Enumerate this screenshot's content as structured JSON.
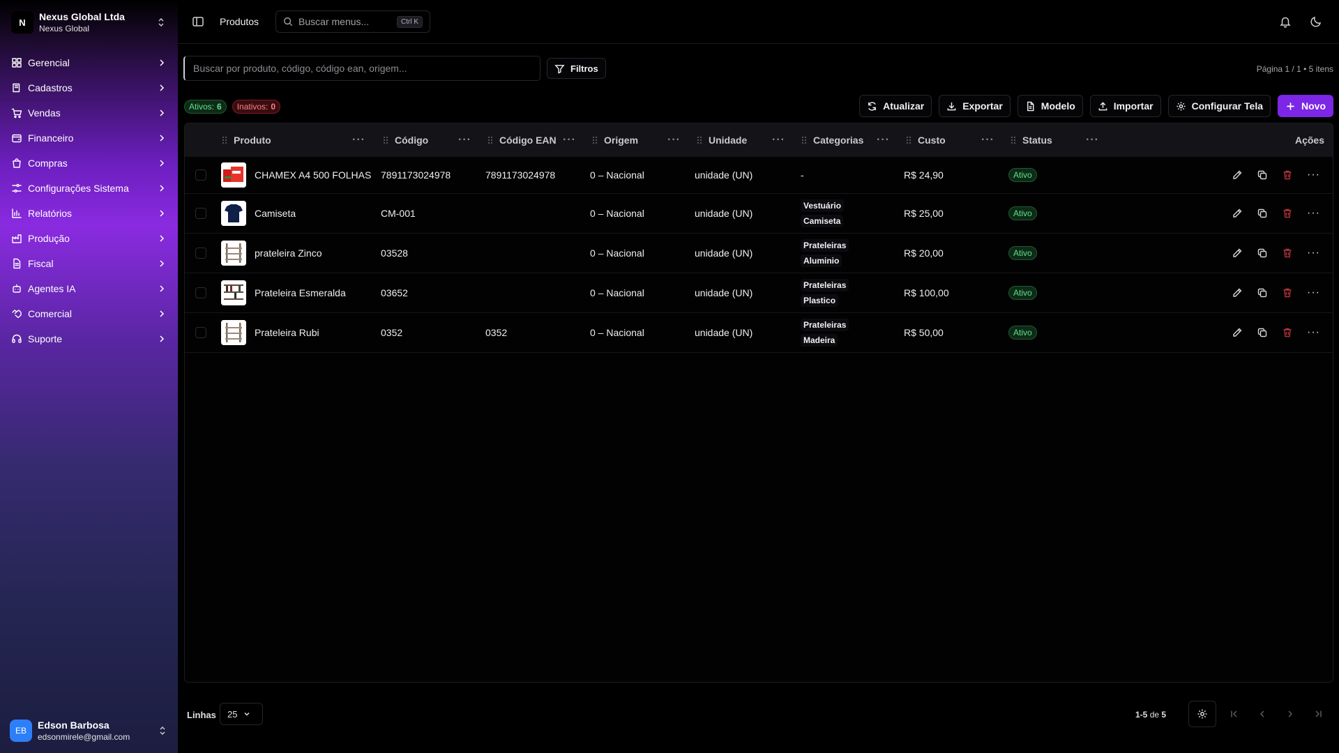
{
  "company": {
    "initial": "N",
    "name": "Nexus Global Ltda",
    "sub": "Nexus Global"
  },
  "nav": [
    {
      "label": "Gerencial",
      "icon": "dashboard-icon"
    },
    {
      "label": "Cadastros",
      "icon": "book-icon"
    },
    {
      "label": "Vendas",
      "icon": "cart-icon"
    },
    {
      "label": "Financeiro",
      "icon": "wallet-icon"
    },
    {
      "label": "Compras",
      "icon": "shopping-bag-icon"
    },
    {
      "label": "Configurações Sistema",
      "icon": "sliders-icon"
    },
    {
      "label": "Relatórios",
      "icon": "bar-chart-icon"
    },
    {
      "label": "Produção",
      "icon": "factory-icon"
    },
    {
      "label": "Fiscal",
      "icon": "document-icon"
    },
    {
      "label": "Agentes IA",
      "icon": "bot-icon"
    },
    {
      "label": "Comercial",
      "icon": "handshake-icon"
    },
    {
      "label": "Suporte",
      "icon": "headset-icon"
    }
  ],
  "user": {
    "initials": "EB",
    "name": "Edson Barbosa",
    "email": "edsonmirele@gmail.com"
  },
  "topbar": {
    "breadcrumb": "Produtos",
    "menu_search_placeholder": "Buscar menus...",
    "shortcut": "Ctrl K"
  },
  "toolbar": {
    "search_placeholder": "Buscar por produto, código, código ean, origem...",
    "filters_label": "Filtros",
    "page_info": "Página 1 / 1 • 5 itens",
    "active_label": "Ativos:",
    "active_count": "6",
    "inactive_label": "Inativos:",
    "inactive_count": "0",
    "refresh_label": "Atualizar",
    "export_label": "Exportar",
    "model_label": "Modelo",
    "import_label": "Importar",
    "configure_label": "Configurar Tela",
    "new_label": "Novo"
  },
  "table": {
    "columns": [
      "Produto",
      "Código",
      "Código EAN",
      "Origem",
      "Unidade",
      "Categorias",
      "Custo",
      "Status",
      "Ações"
    ],
    "rows": [
      {
        "name": "CHAMEX A4 500 FOLHAS",
        "code": "7891173024978",
        "ean": "7891173024978",
        "origin": "0 – Nacional",
        "unit": "unidade (UN)",
        "categories": [
          "-"
        ],
        "cost": "R$ 24,90",
        "status": "Ativo",
        "thumb": "red-paper"
      },
      {
        "name": "Camiseta",
        "code": "CM-001",
        "ean": "",
        "origin": "0 – Nacional",
        "unit": "unidade (UN)",
        "categories": [
          "Vestuário",
          "Camiseta"
        ],
        "cost": "R$ 25,00",
        "status": "Ativo",
        "thumb": "navy-shirt"
      },
      {
        "name": "prateleira Zinco",
        "code": "03528",
        "ean": "",
        "origin": "0 – Nacional",
        "unit": "unidade (UN)",
        "categories": [
          "Prateleiras",
          "Aluminio"
        ],
        "cost": "R$ 20,00",
        "status": "Ativo",
        "thumb": "shelf"
      },
      {
        "name": "Prateleira Esmeralda",
        "code": "03652",
        "ean": "",
        "origin": "0 – Nacional",
        "unit": "unidade (UN)",
        "categories": [
          "Prateleiras",
          "Plastico"
        ],
        "cost": "R$ 100,00",
        "status": "Ativo",
        "thumb": "shelf-dark"
      },
      {
        "name": "Prateleira Rubi",
        "code": "0352",
        "ean": "0352",
        "origin": "0 – Nacional",
        "unit": "unidade (UN)",
        "categories": [
          "Prateleiras",
          "Madeira"
        ],
        "cost": "R$ 50,00",
        "status": "Ativo",
        "thumb": "shelf"
      }
    ]
  },
  "footer": {
    "rows_label": "Linhas",
    "rows_value": "25",
    "range_text": "1-5",
    "range_of": "de",
    "range_total": "5"
  },
  "colors": {
    "accent": "#7c26e6",
    "active_green": "#5fe08a",
    "inactive_red": "#ff7f85",
    "delete_red": "#b3343b"
  }
}
